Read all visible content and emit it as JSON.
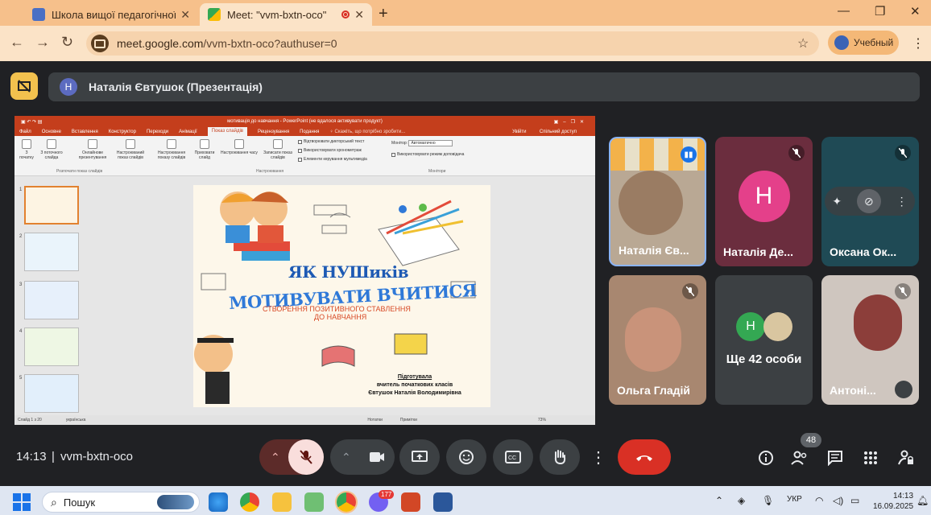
{
  "browser": {
    "tabs": [
      {
        "title": "Школа вищої педагогічної ма",
        "close": "✕"
      },
      {
        "title": "Meet: \"vvm-bxtn-oco\"",
        "close": "✕"
      }
    ],
    "new_tab": "+",
    "url_host": "meet.google.com",
    "url_path": "/vvm-bxtn-oco?authuser=0",
    "profile_label": "Учебный"
  },
  "meet": {
    "presenter_initial": "Н",
    "presenter_label": "Наталія Євтушок (Презентація)",
    "time": "14:13",
    "meeting_code": "vvm-bxtn-oco",
    "people_count": "48"
  },
  "ppt": {
    "window_title": "мотивація до навчання - PowerPoint (не вдалося активувати продукт)",
    "tabs": [
      "Файл",
      "Основне",
      "Вставлення",
      "Конструктор",
      "Переходи",
      "Анімації",
      "Показ слайдів",
      "Рецензування",
      "Подання"
    ],
    "ask": "♀ Скажіть, що потрібно зробити...",
    "sign_in": "Увійти",
    "share": "Спільний доступ",
    "ribbon": {
      "b1": "З початку",
      "b2": "З поточного слайда",
      "b3": "Онлайнове презентування",
      "b4": "Настроюваний показ слайдів",
      "b5": "Настроювання показу слайдів",
      "b6": "Приховати слайд",
      "b7": "Настроювання часу",
      "b8": "Записати показ слайдів",
      "c1": "Відтворювати дикторський текст",
      "c2": "Використовувати хронометраж",
      "c3": "Елементи керування мультимедіа",
      "monitor_label": "Монітор:",
      "monitor_value": "Автоматично",
      "c4": "Використовувати режим доповідача",
      "g1": "Розпочати показ слайдів",
      "g2": "Настроювання",
      "g3": "Монітори"
    },
    "thumb_numbers": [
      "1",
      "2",
      "3",
      "4",
      "5"
    ],
    "slide": {
      "title1": "ЯК НУШиків",
      "title2": "МОТИВУВАТИ ВЧИТИСЯ",
      "subtitle1": "СТВОРЕННЯ ПОЗИТИВНОГО СТАВЛЕННЯ",
      "subtitle2": "ДО НАВЧАННЯ",
      "author1": "Підготувала",
      "author2": "вчитель початкових класів",
      "author3": "Євтушок Наталія Володимирівна"
    },
    "status": {
      "slide": "Слайд 1 з 20",
      "lang": "українська",
      "notes": "Нотатки",
      "comments": "Примітки",
      "zoom": "73%"
    }
  },
  "participants": [
    {
      "name": "Наталія Єв...",
      "muted": false
    },
    {
      "name": "Наталія Де...",
      "initial": "Н",
      "muted": true
    },
    {
      "name": "Оксана Ок...",
      "muted": true
    },
    {
      "name": "Ольга Гладій",
      "muted": true
    },
    {
      "name": "Ще 42 особи",
      "initial": "Н"
    },
    {
      "name": "Антоні...",
      "muted": true
    }
  ],
  "taskbar": {
    "search": "Пошук",
    "badge": "177",
    "lang": "УКР",
    "time": "14:13",
    "date": "16.09.2025"
  }
}
